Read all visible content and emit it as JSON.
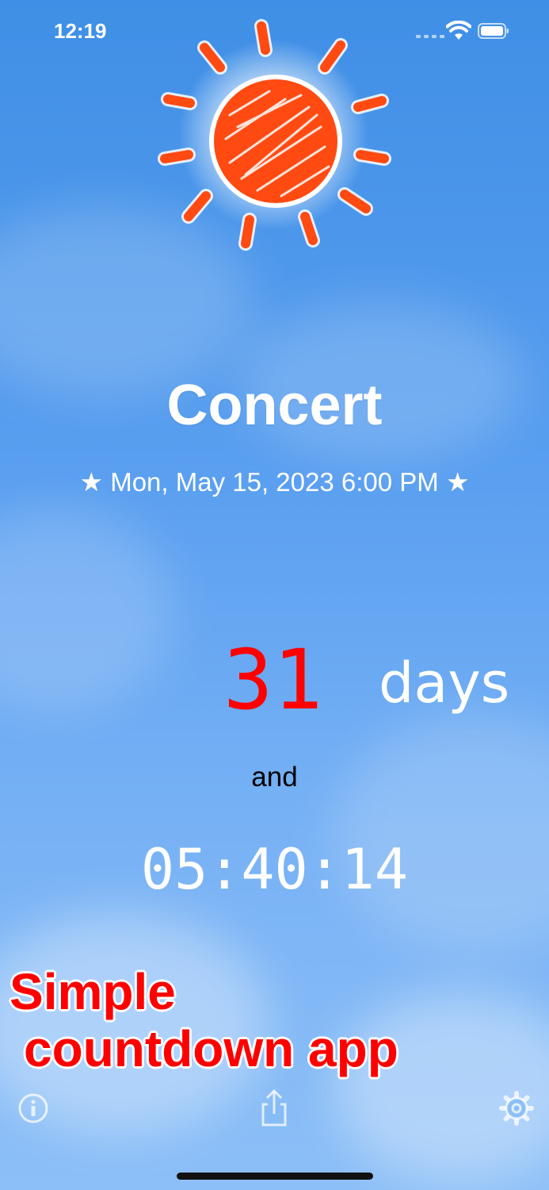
{
  "status_bar": {
    "time": "12:19"
  },
  "event": {
    "title": "Concert",
    "date": "★ Mon, May 15, 2023 6:00 PM ★"
  },
  "countdown": {
    "days": "31",
    "days_label": "days",
    "connector": "and",
    "time_left": "05:40:14"
  },
  "promo": {
    "line1": "Simple",
    "line2": "countdown app"
  },
  "toolbar": {
    "info_icon": "info-icon",
    "share_icon": "share-icon",
    "settings_icon": "gear-icon"
  },
  "colors": {
    "sky": "#5a9ff0",
    "sun": "#ff4a12",
    "days_number": "#ff0000",
    "promo_text": "#ff0000"
  }
}
